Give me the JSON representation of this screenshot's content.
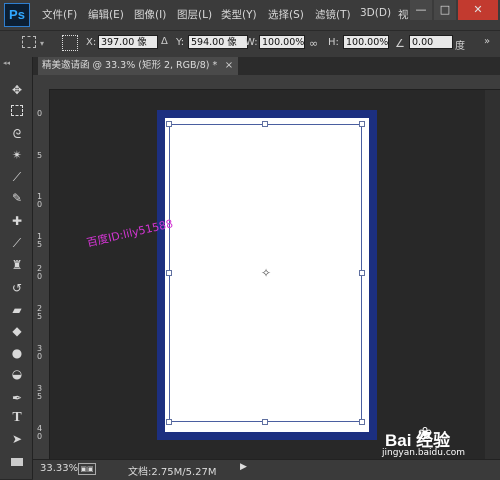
{
  "app": {
    "logo": "Ps"
  },
  "menu": [
    "文件(F)",
    "编辑(E)",
    "图像(I)",
    "图层(L)",
    "类型(Y)",
    "选择(S)",
    "滤镜(T)",
    "3D(D)",
    "视"
  ],
  "window_controls": {
    "minimize": "—",
    "maximize": "□",
    "close": "✕"
  },
  "options": {
    "x_label": "X:",
    "x_value": "397.00 像",
    "y_label": "Y:",
    "y_value": "594.00 像",
    "w_label": "W:",
    "w_value": "100.00%",
    "link_icon": "∞",
    "h_label": "H:",
    "h_value": "100.00%",
    "angle_icon": "∠",
    "angle_value": "0.00",
    "angle_unit": "度"
  },
  "tools": [
    "move-tool-icon",
    "marquee-tool-icon",
    "lasso-tool-icon",
    "magic-wand-icon",
    "crop-tool-icon",
    "eyedropper-icon",
    "healing-brush-icon",
    "brush-tool-icon",
    "clone-stamp-icon",
    "history-brush-icon",
    "eraser-icon",
    "paint-bucket-icon",
    "blur-tool-icon",
    "dodge-tool-icon",
    "pen-tool-icon",
    "type-tool-icon",
    "path-select-icon",
    "rectangle-tool-icon"
  ],
  "document": {
    "tab_title": "精美邀请函 @ 33.3% (矩形 2, RGB/8) *",
    "tab_close": "×"
  },
  "vruler_ticks": [
    "0",
    "5",
    "1\n0",
    "1\n5",
    "2\n0",
    "2\n5",
    "3\n0",
    "3\n5",
    "4\n0"
  ],
  "watermark": "百度ID:lily51588",
  "status": {
    "zoom": "33.33%",
    "doc_size": "文档:2.75M/5.27M",
    "arrow": "▶"
  },
  "baidu": {
    "logo_text": "Bai  经验",
    "url": "jingyan.baidu.com"
  },
  "colors": {
    "frame_blue": "#1c2f80",
    "ps_blue": "#31a8ff"
  }
}
